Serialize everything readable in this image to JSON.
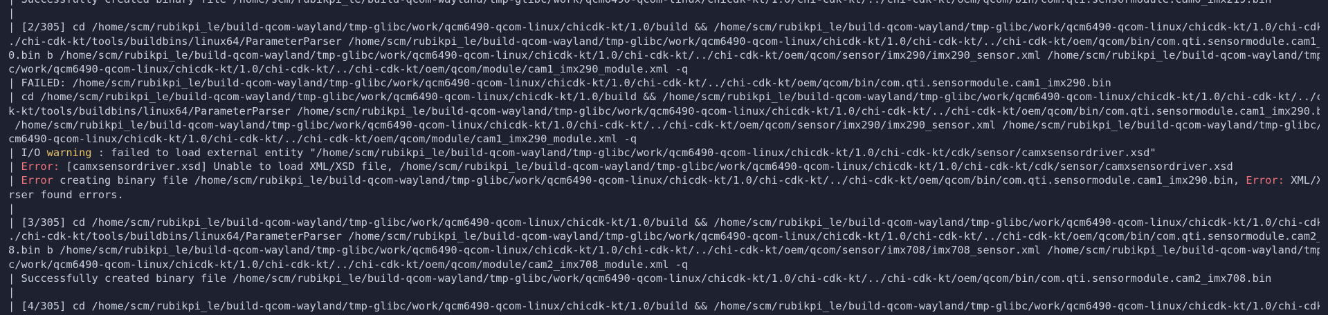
{
  "terminal": {
    "colors": {
      "background": "#1e2230",
      "text": "#c8cede",
      "warning": "#e8c266",
      "error": "#f07178"
    },
    "lines": [
      [
        {
          "t": "| Successfully created binary file /home/scm/rubikpi_le/build-qcom-wayland/tmp-glibc/work/qcm6490-qcom-linux/chicdk-kt/1.0/chi-cdk-kt/../chi-cdk-kt/oem/qcom/bin/com.qti.sensormodule.cam0_imx219.bin"
        }
      ],
      [
        {
          "t": "|"
        }
      ],
      [
        {
          "t": "| [2/305] cd /home/scm/rubikpi_le/build-qcom-wayland/tmp-glibc/work/qcm6490-qcom-linux/chicdk-kt/1.0/build && /home/scm/rubikpi_le/build-qcom-wayland/tmp-glibc/work/qcm6490-qcom-linux/chicdk-kt/1.0/chi-cdk-kt/."
        }
      ],
      [
        {
          "t": "./chi-cdk-kt/tools/buildbins/linux64/ParameterParser /home/scm/rubikpi_le/build-qcom-wayland/tmp-glibc/work/qcm6490-qcom-linux/chicdk-kt/1.0/chi-cdk-kt/../chi-cdk-kt/oem/qcom/bin/com.qti.sensormodule.cam1_imx29"
        }
      ],
      [
        {
          "t": "0.bin b /home/scm/rubikpi_le/build-qcom-wayland/tmp-glibc/work/qcm6490-qcom-linux/chicdk-kt/1.0/chi-cdk-kt/../chi-cdk-kt/oem/qcom/sensor/imx290/imx290_sensor.xml /home/scm/rubikpi_le/build-qcom-wayland/tmp-glib"
        }
      ],
      [
        {
          "t": "c/work/qcm6490-qcom-linux/chicdk-kt/1.0/chi-cdk-kt/../chi-cdk-kt/oem/qcom/module/cam1_imx290_module.xml -q"
        }
      ],
      [
        {
          "t": "| FAILED: /home/scm/rubikpi_le/build-qcom-wayland/tmp-glibc/work/qcm6490-qcom-linux/chicdk-kt/1.0/chi-cdk-kt/../chi-cdk-kt/oem/qcom/bin/com.qti.sensormodule.cam1_imx290.bin"
        }
      ],
      [
        {
          "t": "| cd /home/scm/rubikpi_le/build-qcom-wayland/tmp-glibc/work/qcm6490-qcom-linux/chicdk-kt/1.0/build && /home/scm/rubikpi_le/build-qcom-wayland/tmp-glibc/work/qcm6490-qcom-linux/chicdk-kt/1.0/chi-cdk-kt/../chi-cd"
        }
      ],
      [
        {
          "t": "k-kt/tools/buildbins/linux64/ParameterParser /home/scm/rubikpi_le/build-qcom-wayland/tmp-glibc/work/qcm6490-qcom-linux/chicdk-kt/1.0/chi-cdk-kt/../chi-cdk-kt/oem/qcom/bin/com.qti.sensormodule.cam1_imx290.bin b"
        }
      ],
      [
        {
          "t": " /home/scm/rubikpi_le/build-qcom-wayland/tmp-glibc/work/qcm6490-qcom-linux/chicdk-kt/1.0/chi-cdk-kt/../chi-cdk-kt/oem/qcom/sensor/imx290/imx290_sensor.xml /home/scm/rubikpi_le/build-qcom-wayland/tmp-glibc/work/q"
        }
      ],
      [
        {
          "t": "cm6490-qcom-linux/chicdk-kt/1.0/chi-cdk-kt/../chi-cdk-kt/oem/qcom/module/cam1_imx290_module.xml -q"
        }
      ],
      [
        {
          "t": "| I/O "
        },
        {
          "t": "warning",
          "c": "w"
        },
        {
          "t": " : failed to load external entity \"/home/scm/rubikpi_le/build-qcom-wayland/tmp-glibc/work/qcm6490-qcom-linux/chicdk-kt/1.0/chi-cdk-kt/cdk/sensor/camxsensordriver.xsd\""
        }
      ],
      [
        {
          "t": "| "
        },
        {
          "t": "Error:",
          "c": "e"
        },
        {
          "t": " [camxsensordriver.xsd] Unable to load XML/XSD file, /home/scm/rubikpi_le/build-qcom-wayland/tmp-glibc/work/qcm6490-qcom-linux/chicdk-kt/1.0/chi-cdk-kt/cdk/sensor/camxsensordriver.xsd"
        }
      ],
      [
        {
          "t": "| "
        },
        {
          "t": "Error",
          "c": "e"
        },
        {
          "t": " creating binary file /home/scm/rubikpi_le/build-qcom-wayland/tmp-glibc/work/qcm6490-qcom-linux/chicdk-kt/1.0/chi-cdk-kt/../chi-cdk-kt/oem/qcom/bin/com.qti.sensormodule.cam1_imx290.bin, "
        },
        {
          "t": "Error:",
          "c": "e"
        },
        {
          "t": " XML/XSD pa"
        }
      ],
      [
        {
          "t": "rser found errors."
        }
      ],
      [
        {
          "t": "|"
        }
      ],
      [
        {
          "t": "| [3/305] cd /home/scm/rubikpi_le/build-qcom-wayland/tmp-glibc/work/qcm6490-qcom-linux/chicdk-kt/1.0/build && /home/scm/rubikpi_le/build-qcom-wayland/tmp-glibc/work/qcm6490-qcom-linux/chicdk-kt/1.0/chi-cdk-kt/."
        }
      ],
      [
        {
          "t": "./chi-cdk-kt/tools/buildbins/linux64/ParameterParser /home/scm/rubikpi_le/build-qcom-wayland/tmp-glibc/work/qcm6490-qcom-linux/chicdk-kt/1.0/chi-cdk-kt/../chi-cdk-kt/oem/qcom/bin/com.qti.sensormodule.cam2_imx70"
        }
      ],
      [
        {
          "t": "8.bin b /home/scm/rubikpi_le/build-qcom-wayland/tmp-glibc/work/qcm6490-qcom-linux/chicdk-kt/1.0/chi-cdk-kt/../chi-cdk-kt/oem/qcom/sensor/imx708/imx708_sensor.xml /home/scm/rubikpi_le/build-qcom-wayland/tmp-glib"
        }
      ],
      [
        {
          "t": "c/work/qcm6490-qcom-linux/chicdk-kt/1.0/chi-cdk-kt/../chi-cdk-kt/oem/qcom/module/cam2_imx708_module.xml -q"
        }
      ],
      [
        {
          "t": "| Successfully created binary file /home/scm/rubikpi_le/build-qcom-wayland/tmp-glibc/work/qcm6490-qcom-linux/chicdk-kt/1.0/chi-cdk-kt/../chi-cdk-kt/oem/qcom/bin/com.qti.sensormodule.cam2_imx708.bin"
        }
      ],
      [
        {
          "t": "|"
        }
      ],
      [
        {
          "t": "| [4/305] cd /home/scm/rubikpi_le/build-qcom-wayland/tmp-glibc/work/qcm6490-qcom-linux/chicdk-kt/1.0/build && /home/scm/rubikpi_le/build-qcom-wayland/tmp-glibc/work/qcm6490-qcom-linux/chicdk-kt/1.0/chi-cdk-kt/."
        }
      ],
      [
        {
          "t": "./chi-cdk-kt/tools/buildbins/linux64/ParameterParser /home/scm/rubikpi_le/build-qcom-wayland/tmp-glibc/work/qcm6490-qcom-linux/chicdk-kt/1.0/chi-cdk-kt/../chi-cdk-kt/oem/qcom/bin/com.qti.sensormodule.cam3_imx70"
        }
      ]
    ]
  }
}
